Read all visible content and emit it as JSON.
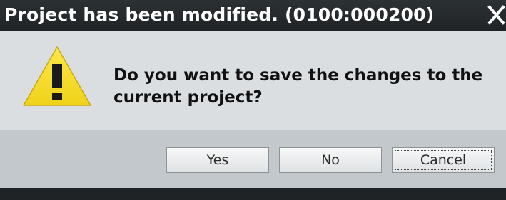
{
  "dialog": {
    "title": "Project has been modified. (0100:000200)",
    "message": "Do you want to save the changes to the current project?",
    "buttons": {
      "yes": "Yes",
      "no": "No",
      "cancel": "Cancel"
    },
    "focused_button": "cancel",
    "icons": {
      "warning": "warning-icon",
      "close": "close-icon"
    }
  },
  "colors": {
    "titlebar_bg": "#1f2326",
    "body_bg": "#dadee1",
    "footer_bg": "#c3c8cc",
    "warning_yellow": "#f5de2b"
  }
}
